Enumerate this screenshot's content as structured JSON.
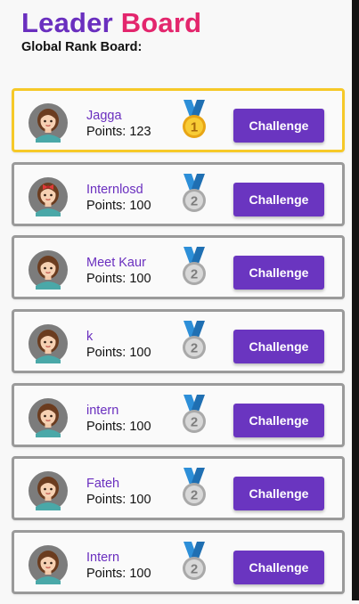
{
  "header": {
    "title_part1": "Leader",
    "title_part2": "Board",
    "subtitle": "Global Rank Board:"
  },
  "colors": {
    "accent_purple": "#6a35c0",
    "title_pink": "#e3266d",
    "first_place_border": "#f6c928",
    "card_border": "#9a9a9a"
  },
  "entries": [
    {
      "name": "Jagga",
      "points": "Points: 123",
      "medal_number": "1",
      "medal_icon": "gold-medal-icon",
      "avatar_icon": "female-avatar-icon",
      "button": "Challenge"
    },
    {
      "name": "Internlosd",
      "points": "Points: 100",
      "medal_number": "2",
      "medal_icon": "silver-medal-icon",
      "avatar_icon": "female-avatar-red-bow-icon",
      "button": "Challenge"
    },
    {
      "name": "Meet Kaur",
      "points": "Points: 100",
      "medal_number": "2",
      "medal_icon": "silver-medal-icon",
      "avatar_icon": "female-avatar-icon",
      "button": "Challenge"
    },
    {
      "name": "k",
      "points": "Points: 100",
      "medal_number": "2",
      "medal_icon": "silver-medal-icon",
      "avatar_icon": "female-avatar-icon",
      "button": "Challenge"
    },
    {
      "name": "intern",
      "points": "Points: 100",
      "medal_number": "2",
      "medal_icon": "silver-medal-icon",
      "avatar_icon": "female-avatar-icon",
      "button": "Challenge"
    },
    {
      "name": "Fateh",
      "points": "Points: 100",
      "medal_number": "2",
      "medal_icon": "silver-medal-icon",
      "avatar_icon": "female-avatar-icon",
      "button": "Challenge"
    },
    {
      "name": "Intern",
      "points": "Points: 100",
      "medal_number": "2",
      "medal_icon": "silver-medal-icon",
      "avatar_icon": "female-avatar-icon",
      "button": "Challenge"
    }
  ]
}
